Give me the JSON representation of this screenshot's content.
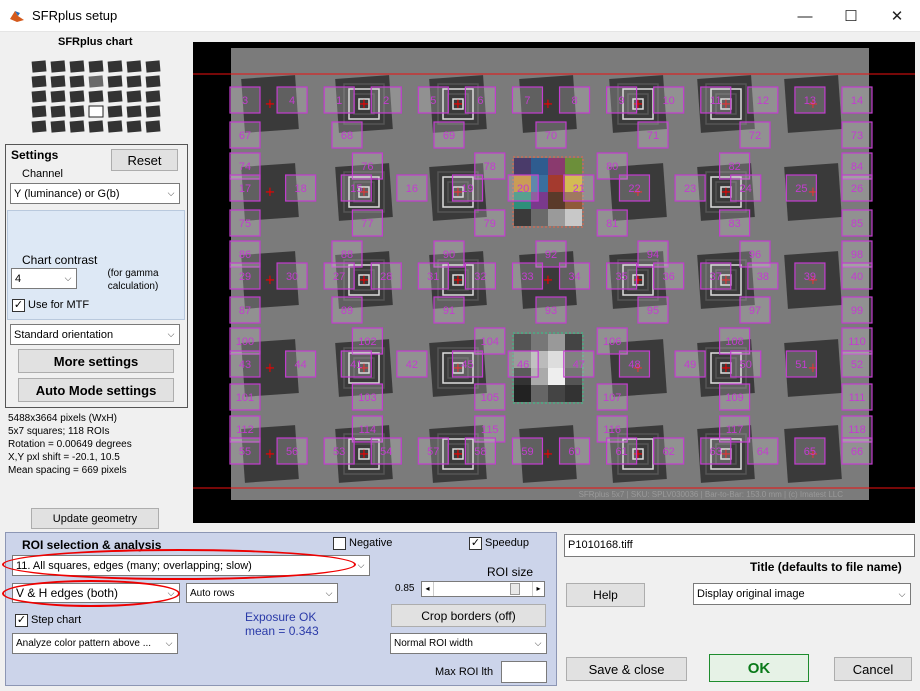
{
  "window": {
    "title": "SFRplus setup",
    "minimize": "—",
    "maximize": "☐",
    "close": "✕"
  },
  "left": {
    "chart_label": "SFRplus chart",
    "settings": {
      "heading": "Settings",
      "reset": "Reset",
      "channel_label": "Channel",
      "channel_value": "Y (luminance) or G(b)",
      "contrast_label": "Chart contrast",
      "contrast_value": "4",
      "gamma_note": "(for gamma calculation)",
      "use_mtf": "Use for MTF",
      "orientation": "Standard orientation",
      "more_settings": "More settings",
      "auto_mode": "Auto Mode settings"
    },
    "info": [
      "5488x3664 pixels (WxH)",
      "5x7 squares; 118 ROIs",
      "Rotation = 0.00649 degrees",
      "X,Y pxl shift = -20.1, 10.5",
      "Mean spacing = 669 pixels"
    ],
    "update_geometry": "Update geometry"
  },
  "image": {
    "footer_text": "SFRplus 5x7 | SKU: SPLV030036 | Bar-to-Bar: 153.0 mm | (c) Imatest LLC",
    "rows": [
      [
        "3",
        "4",
        "1",
        "2",
        "5",
        "6",
        "7",
        "8",
        "9",
        "10",
        "11",
        "12",
        "13",
        "14"
      ],
      [
        "67",
        "68",
        "69",
        "70",
        "71",
        "72",
        "73"
      ],
      [
        "74",
        "76",
        "78",
        "80",
        "82",
        "84"
      ],
      [
        "17",
        "18",
        "15",
        "16",
        "19",
        "20",
        "21",
        "22",
        "23",
        "24",
        "25",
        "26"
      ],
      [
        "75",
        "77",
        "79",
        "81",
        "83",
        "85"
      ],
      [
        "86",
        "88",
        "90",
        "92",
        "94",
        "96",
        "98"
      ],
      [
        "29",
        "30",
        "27",
        "28",
        "31",
        "32",
        "33",
        "34",
        "35",
        "36",
        "37",
        "38",
        "39",
        "40"
      ],
      [
        "87",
        "89",
        "91",
        "93",
        "95",
        "97",
        "99"
      ],
      [
        "100",
        "102",
        "104",
        "106",
        "108",
        "110"
      ],
      [
        "43",
        "44",
        "41",
        "42",
        "45",
        "46",
        "47",
        "48",
        "49",
        "50",
        "51",
        "52"
      ],
      [
        "101",
        "103",
        "105",
        "107",
        "109",
        "111"
      ],
      [
        "112",
        "114",
        "115",
        "116",
        "117",
        "118"
      ],
      [
        "55",
        "56",
        "53",
        "54",
        "57",
        "58",
        "59",
        "60",
        "61",
        "62",
        "63",
        "64",
        "65",
        "66"
      ]
    ]
  },
  "roi": {
    "heading": "ROI selection & analysis",
    "negative": "Negative",
    "speedup": "Speedup",
    "selection": "11. All squares, edges (many; overlapping; slow)",
    "roi_size_label": "ROI size",
    "roi_size_value": "0.85",
    "edges": "V & H edges (both)",
    "rows_mode": "Auto rows",
    "crop_borders": "Crop borders  (off)",
    "step_chart": "Step chart",
    "exposure_line1": "Exposure OK",
    "exposure_line2": "mean = 0.343",
    "analyze_color": "Analyze color pattern above ...",
    "roi_width": "Normal ROI width",
    "max_roi_label": "Max ROI lth",
    "max_roi_value": ""
  },
  "right": {
    "filename": "P1010168.tiff",
    "title_label": "Title (defaults to file name)",
    "help": "Help",
    "display_option": "Display original image",
    "save_close": "Save & close",
    "ok": "OK",
    "cancel": "Cancel"
  }
}
